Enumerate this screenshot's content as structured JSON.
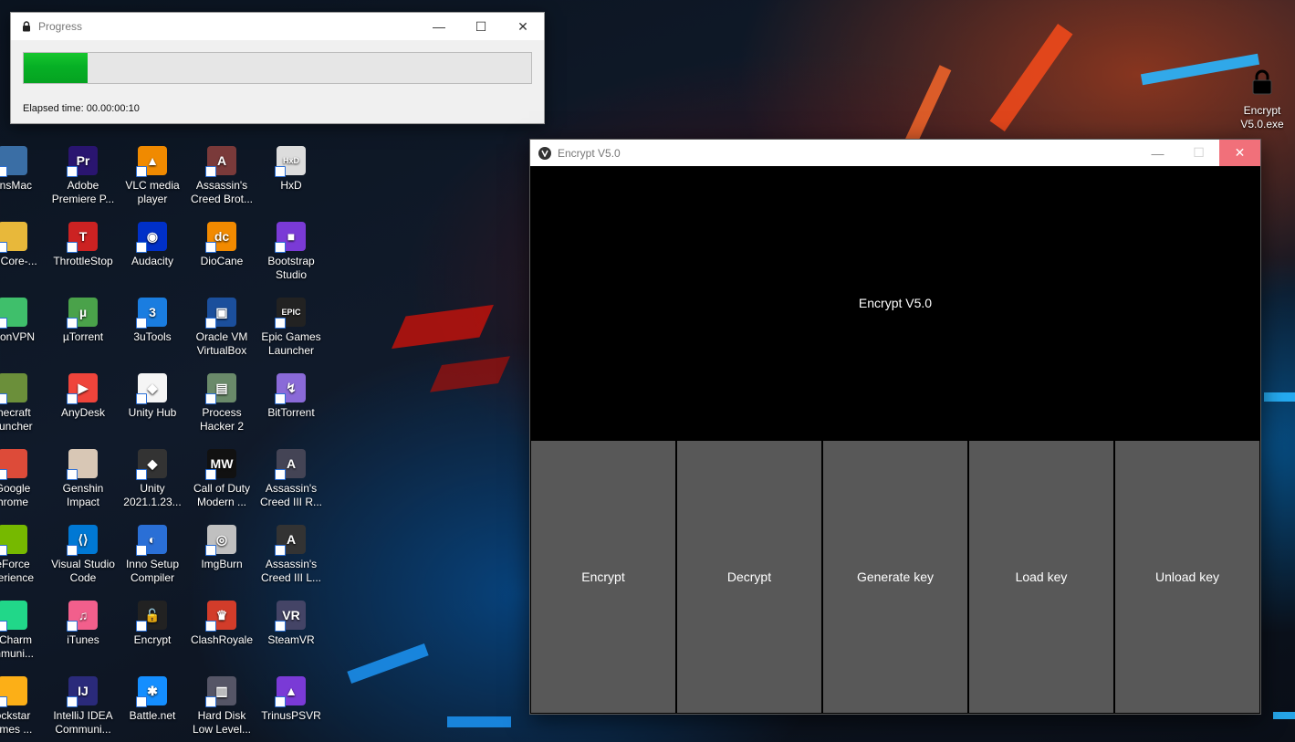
{
  "desktop": {
    "columns": [
      {
        "items": [
          {
            "label": "ansMac",
            "icon": "computer-icon",
            "color": "#3a6ea5"
          },
          {
            "label": "enCore-...",
            "icon": "folder-icon",
            "color": "#e8b83a"
          },
          {
            "label": "otonVPN",
            "icon": "vpn-icon",
            "color": "#3fbf6b"
          },
          {
            "label": "inecraft\nauncher",
            "icon": "minecraft-icon",
            "color": "#6b8f3a"
          },
          {
            "label": "Google\nhrome",
            "icon": "chrome-icon",
            "color": "#dd4b39"
          },
          {
            "label": "eForce\nperience",
            "icon": "geforce-icon",
            "color": "#76b900"
          },
          {
            "label": "yCharm\nmmuni...",
            "icon": "pycharm-icon",
            "color": "#21d789"
          },
          {
            "label": "ockstar\names ...",
            "icon": "rockstar-icon",
            "color": "#fcaf17"
          }
        ]
      },
      {
        "items": [
          {
            "label": "Adobe\nPremiere P...",
            "icon": "premiere-icon",
            "color": "#2a1570",
            "glyph": "Pr"
          },
          {
            "label": "ThrottleStop",
            "icon": "throttlestop-icon",
            "color": "#c22",
            "glyph": "T"
          },
          {
            "label": "µTorrent",
            "icon": "utorrent-icon",
            "color": "#4aa24a",
            "glyph": "µ"
          },
          {
            "label": "AnyDesk",
            "icon": "anydesk-icon",
            "color": "#ef443b",
            "glyph": "▶"
          },
          {
            "label": "Genshin\nImpact",
            "icon": "genshin-icon",
            "color": "#d8c7b5",
            "glyph": ""
          },
          {
            "label": "Visual Studio\nCode",
            "icon": "vscode-icon",
            "color": "#0078d4",
            "glyph": "⟨⟩"
          },
          {
            "label": "iTunes",
            "icon": "itunes-icon",
            "color": "#f25f8c",
            "glyph": "♫"
          },
          {
            "label": "IntelliJ IDEA\nCommuni...",
            "icon": "intellij-icon",
            "color": "#2a2a7a",
            "glyph": "IJ"
          }
        ]
      },
      {
        "items": [
          {
            "label": "VLC media\nplayer",
            "icon": "vlc-icon",
            "color": "#f08a00",
            "glyph": "▲"
          },
          {
            "label": "Audacity",
            "icon": "audacity-icon",
            "color": "#0030c8",
            "glyph": "◉"
          },
          {
            "label": "3uTools",
            "icon": "3utools-icon",
            "color": "#1a7de0",
            "glyph": "3"
          },
          {
            "label": "Unity Hub",
            "icon": "unity-hub-icon",
            "color": "#f5f5f5",
            "glyph": "◆"
          },
          {
            "label": "Unity\n2021.1.23...",
            "icon": "unity-icon",
            "color": "#333",
            "glyph": "◆"
          },
          {
            "label": "Inno Setup\nCompiler",
            "icon": "inno-setup-icon",
            "color": "#2a6fd6",
            "glyph": "◐"
          },
          {
            "label": "Encrypt",
            "icon": "lock-icon",
            "color": "#222",
            "glyph": "🔓"
          },
          {
            "label": "Battle.net",
            "icon": "battlenet-icon",
            "color": "#148eff",
            "glyph": "✱"
          }
        ]
      },
      {
        "items": [
          {
            "label": "Assassin's\nCreed Brot...",
            "icon": "assassins-creed-icon",
            "color": "#7a3a3a",
            "glyph": "A"
          },
          {
            "label": "DioCane",
            "icon": "diocane-icon",
            "color": "#f28a00",
            "glyph": "dc"
          },
          {
            "label": "Oracle VM\nVirtualBox",
            "icon": "virtualbox-icon",
            "color": "#1b4f9c",
            "glyph": "▣"
          },
          {
            "label": "Process\nHacker 2",
            "icon": "process-hacker-icon",
            "color": "#6a8a6a",
            "glyph": "▤"
          },
          {
            "label": "Call of Duty\nModern ...",
            "icon": "call-of-duty-icon",
            "color": "#111",
            "glyph": "MW"
          },
          {
            "label": "ImgBurn",
            "icon": "imgburn-icon",
            "color": "#c0c0c0",
            "glyph": "◎"
          },
          {
            "label": "ClashRoyale",
            "icon": "clash-royale-icon",
            "color": "#d23c2a",
            "glyph": "♛"
          },
          {
            "label": "Hard Disk\nLow Level...",
            "icon": "hard-disk-icon",
            "color": "#556",
            "glyph": "▥"
          }
        ]
      },
      {
        "items": [
          {
            "label": "HxD",
            "icon": "hxd-icon",
            "color": "#ddd",
            "glyph": "HxD"
          },
          {
            "label": "Bootstrap\nStudio",
            "icon": "bootstrap-studio-icon",
            "color": "#7a3ad6",
            "glyph": "■"
          },
          {
            "label": "Epic Games\nLauncher",
            "icon": "epic-games-icon",
            "color": "#222",
            "glyph": "EPIC"
          },
          {
            "label": "BitTorrent",
            "icon": "bittorrent-icon",
            "color": "#8a6ad8",
            "glyph": "↯"
          },
          {
            "label": "Assassin's\nCreed III R...",
            "icon": "assassins-creed-3-icon",
            "color": "#445",
            "glyph": "A"
          },
          {
            "label": "Assassin's\nCreed III L...",
            "icon": "assassins-creed-3-liberation-icon",
            "color": "#333",
            "glyph": "A"
          },
          {
            "label": "SteamVR",
            "icon": "steamvr-icon",
            "color": "#446",
            "glyph": "VR"
          },
          {
            "label": "TrinusPSVR",
            "icon": "trinus-icon",
            "color": "#7a3ad6",
            "glyph": "▲"
          }
        ]
      }
    ],
    "encrypt_exe_label": "Encrypt\nV5.0.exe"
  },
  "progress_window": {
    "title": "Progress",
    "progress": 0.125,
    "elapsed": "Elapsed time: 00.00:00:10",
    "bar_color": "#06b025"
  },
  "encrypt_window": {
    "title": "Encrypt V5.0",
    "heading": "Encrypt V5.0",
    "buttons": [
      "Encrypt",
      "Decrypt",
      "Generate key",
      "Load key",
      "Unload key"
    ],
    "close_color": "#f1707a",
    "button_color": "#585858"
  }
}
